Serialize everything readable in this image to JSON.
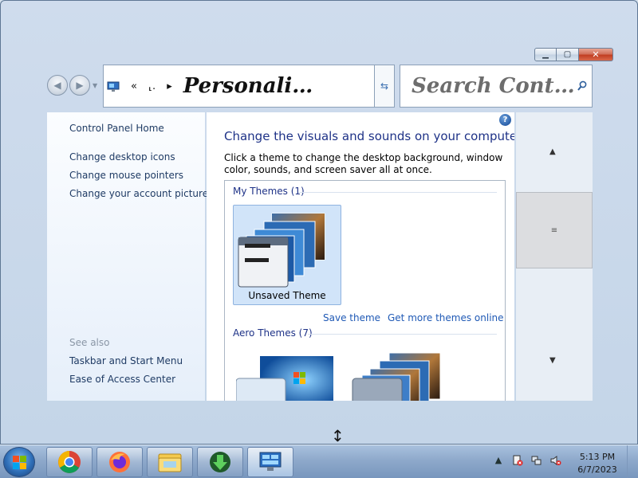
{
  "window": {
    "caption_buttons": {
      "minimize": "▁",
      "maximize": "▢",
      "close": "✕"
    }
  },
  "navbar": {
    "back_icon": "back-arrow-icon",
    "forward_icon": "forward-arrow-icon",
    "address_prefix": "«",
    "address_segment": "⸤.",
    "address_arrow": "▸",
    "address_title": "Personali…",
    "search_placeholder": "Search Cont…"
  },
  "left_pane": {
    "home_link": "Control Panel Home",
    "tasks": [
      "Change desktop icons",
      "Change mouse pointers",
      "Change your account picture"
    ],
    "see_also_label": "See also",
    "see_also": [
      "Taskbar and Start Menu",
      "Ease of Access Center"
    ]
  },
  "content": {
    "help": "?",
    "title": "Change the visuals and sounds on your computer",
    "description": "Click a theme to change the desktop background, window color, sounds, and screen saver all at once.",
    "my_themes_header": "My Themes (1)",
    "unsaved_theme_label": "Unsaved Theme",
    "save_theme_link": "Save theme",
    "more_themes_link": "Get more themes online",
    "aero_themes_header": "Aero Themes (7)"
  },
  "scrollbar": {
    "up": "▲",
    "thumb_grip": "≡",
    "down": "▼"
  },
  "taskbar": {
    "pinned": [
      "chrome-icon",
      "firefox-icon",
      "file-explorer-icon",
      "download-manager-icon",
      "personalization-icon"
    ],
    "clock_time": "5:13 PM",
    "clock_date": "6/7/2023"
  },
  "colors": {
    "link": "#1f59b5",
    "heading": "#1e3287",
    "close_button": "#c23f22"
  }
}
